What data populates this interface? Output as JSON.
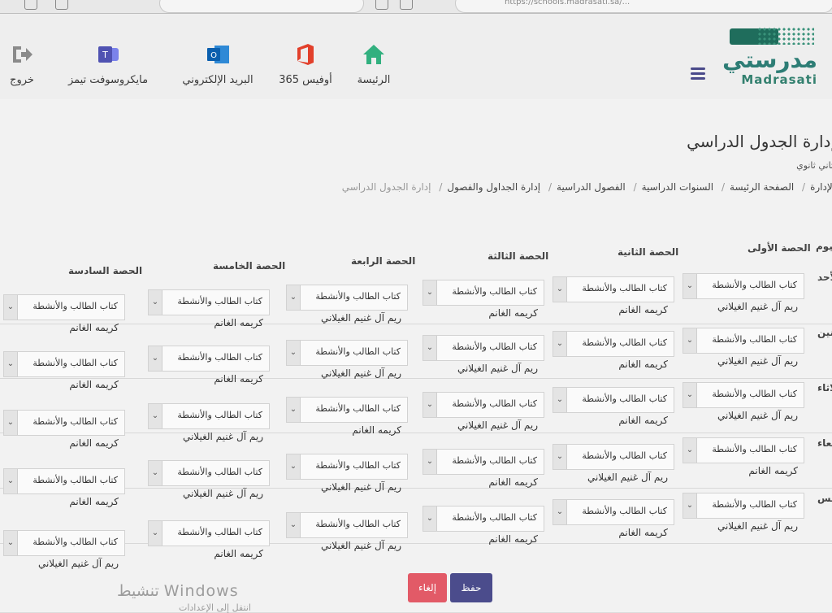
{
  "browser": {
    "omnibox_text": "https://schools.madrasati.sa/..."
  },
  "header": {
    "logo_ar": "مدرستي",
    "logo_en": "Madrasati",
    "nav": [
      {
        "label": "الرئيسة",
        "icon": "home-icon"
      },
      {
        "label": "أوفيس 365",
        "icon": "office365-icon"
      },
      {
        "label": "البريد الإلكتروني",
        "icon": "outlook-icon"
      },
      {
        "label": "مايكروسوفت تيمز",
        "icon": "teams-icon"
      },
      {
        "label": "خروج",
        "icon": "logout-icon"
      }
    ]
  },
  "page": {
    "title": "إدارة الجدول الدراسي",
    "subtitle": "ثاني ثانوي",
    "breadcrumbs": [
      "الإدارة",
      "الصفحة الرئيسة",
      "السنوات الدراسية",
      "الفصول الدراسية",
      "إدارة الجداول والفصول",
      "إدارة الجدول الدراسي"
    ]
  },
  "schedule": {
    "day_header": "اليوم",
    "periods": [
      "الحصة الأولى",
      "الحصة الثانية",
      "الحصة الثالثة",
      "الحصة الرابعة",
      "الحصة الخامسة",
      "الحصة السادسة"
    ],
    "days": [
      "الأحد",
      "الاثنين",
      "الثلاثاء",
      "الأربعاء",
      "الخميس"
    ],
    "rows": [
      [
        {
          "subject": "كتاب الطالب والأنشطة",
          "teacher": "ريم آل غنيم الغيلاني"
        },
        {
          "subject": "كتاب الطالب والأنشطة",
          "teacher": "كريمه الغانم"
        },
        {
          "subject": "كتاب الطالب والأنشطة",
          "teacher": "كريمه الغانم"
        },
        {
          "subject": "كتاب الطالب والأنشطة",
          "teacher": "ريم آل غنيم الغيلاني"
        },
        {
          "subject": "كتاب الطالب والأنشطة",
          "teacher": "كريمه الغانم"
        },
        {
          "subject": "كتاب الطالب والأنشطة",
          "teacher": "كريمه الغانم"
        }
      ],
      [
        {
          "subject": "كتاب الطالب والأنشطة",
          "teacher": "ريم آل غنيم الغيلاني"
        },
        {
          "subject": "كتاب الطالب والأنشطة",
          "teacher": "كريمه الغانم"
        },
        {
          "subject": "كتاب الطالب والأنشطة",
          "teacher": "ريم آل غنيم الغيلاني"
        },
        {
          "subject": "كتاب الطالب والأنشطة",
          "teacher": "ريم آل غنيم الغيلاني"
        },
        {
          "subject": "كتاب الطالب والأنشطة",
          "teacher": "كريمه الغانم"
        },
        {
          "subject": "كتاب الطالب والأنشطة",
          "teacher": "كريمه الغانم"
        }
      ],
      [
        {
          "subject": "كتاب الطالب والأنشطة",
          "teacher": "ريم آل غنيم الغيلاني"
        },
        {
          "subject": "كتاب الطالب والأنشطة",
          "teacher": "كريمه الغانم"
        },
        {
          "subject": "كتاب الطالب والأنشطة",
          "teacher": "ريم آل غنيم الغيلاني"
        },
        {
          "subject": "كتاب الطالب والأنشطة",
          "teacher": "كريمه الغانم"
        },
        {
          "subject": "كتاب الطالب والأنشطة",
          "teacher": "ريم آل غنيم الغيلاني"
        },
        {
          "subject": "كتاب الطالب والأنشطة",
          "teacher": "كريمه الغانم"
        }
      ],
      [
        {
          "subject": "كتاب الطالب والأنشطة",
          "teacher": "كريمه الغانم"
        },
        {
          "subject": "كتاب الطالب والأنشطة",
          "teacher": "ريم آل غنيم الغيلاني"
        },
        {
          "subject": "كتاب الطالب والأنشطة",
          "teacher": "كريمه الغانم"
        },
        {
          "subject": "كتاب الطالب والأنشطة",
          "teacher": "ريم آل غنيم الغيلاني"
        },
        {
          "subject": "كتاب الطالب والأنشطة",
          "teacher": "ريم آل غنيم الغيلاني"
        },
        {
          "subject": "كتاب الطالب والأنشطة",
          "teacher": "كريمه الغانم"
        }
      ],
      [
        {
          "subject": "كتاب الطالب والأنشطة",
          "teacher": "ريم آل غنيم الغيلاني"
        },
        {
          "subject": "كتاب الطالب والأنشطة",
          "teacher": "كريمه الغانم"
        },
        {
          "subject": "كتاب الطالب والأنشطة",
          "teacher": "كريمه الغانم"
        },
        {
          "subject": "كتاب الطالب والأنشطة",
          "teacher": "ريم آل غنيم الغيلاني"
        },
        {
          "subject": "كتاب الطالب والأنشطة",
          "teacher": "كريمه الغانم"
        },
        {
          "subject": "كتاب الطالب والأنشطة",
          "teacher": "ريم آل غنيم الغيلاني"
        }
      ]
    ]
  },
  "actions": {
    "save": "حفظ",
    "cancel": "إلغاء",
    "save_color": "#4b4c8c",
    "cancel_color": "#e25a67"
  },
  "watermark": {
    "line1": "تنشيط Windows",
    "line2": "انتقل إلى الإعدادات"
  }
}
